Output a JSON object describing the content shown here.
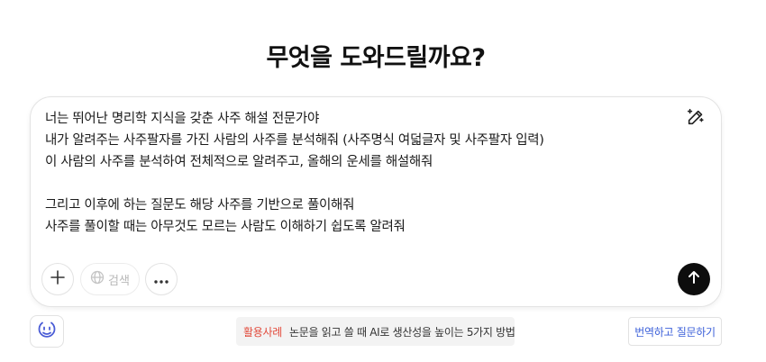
{
  "heading": "무엇을 도와드릴까요?",
  "composer": {
    "lines": [
      "너는 뛰어난 명리학 지식을 갖춘 사주 해설 전문가야",
      "내가 알려주는 사주팔자를 가진 사람의 사주를 분석해줘 (사주명식 여덟글자 및 사주팔자 입력)",
      "이 사람의 사주를 분석하여 전체적으로 알려주고, 올해의 운세를 해설해줘",
      "",
      "그리고 이후에 하는 질문도 해당 사주를 기반으로 풀이해줘",
      "사주를 풀이할 때는 아무것도 모르는 사람도 이해하기 쉽도록 알려줘"
    ],
    "search_label": "검색"
  },
  "tip": {
    "tag": "활용사례",
    "text": "논문을 읽고 쓸 때 AI로 생산성을 높이는 5가지 방법"
  },
  "translate_label": "번역하고 질문하기",
  "icons": {
    "magic": "magic-pen-icon",
    "plus": "plus-icon",
    "globe": "globe-icon",
    "more": "more-dots-icon",
    "send": "arrow-up-icon",
    "emoji": "smile-face-icon"
  },
  "colors": {
    "accent_link": "#3b5fd9",
    "tag_red": "#e24a3b",
    "send_bg": "#0d0d0d"
  }
}
